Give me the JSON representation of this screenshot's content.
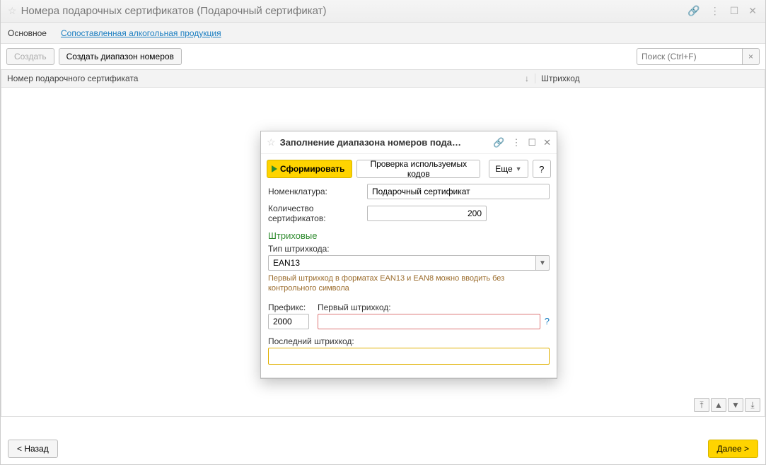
{
  "window": {
    "title": "Номера подарочных сертификатов (Подарочный сертификат)"
  },
  "tabs": {
    "main": "Основное",
    "alcohol": "Сопоставленная алкогольная продукция"
  },
  "toolbar": {
    "create": "Создать",
    "create_range": "Создать диапазон номеров",
    "search_placeholder": "Поиск (Ctrl+F)"
  },
  "table": {
    "col_number": "Номер подарочного сертификата",
    "col_barcode": "Штрихкод"
  },
  "footer": {
    "back": "< Назад",
    "next": "Далее >"
  },
  "dialog": {
    "title": "Заполнение диапазона номеров пода…",
    "generate": "Сформировать",
    "check_codes": "Проверка используемых кодов",
    "more": "Еще",
    "help": "?",
    "nomenclature_label": "Номенклатура:",
    "nomenclature_value": "Подарочный сертификат",
    "qty_label": "Количество сертификатов:",
    "qty_value": "200",
    "section_barcodes": "Штриховые",
    "barcode_type_label": "Тип штрихкода:",
    "barcode_type_value": "EAN13",
    "barcode_hint": "Первый штрихкод в форматах EAN13 и EAN8 можно вводить без контрольного символа",
    "prefix_label": "Префикс:",
    "prefix_value": "2000",
    "first_barcode_label": "Первый штрихкод:",
    "first_barcode_value": "",
    "last_barcode_label": "Последний штрихкод:",
    "last_barcode_value": ""
  }
}
